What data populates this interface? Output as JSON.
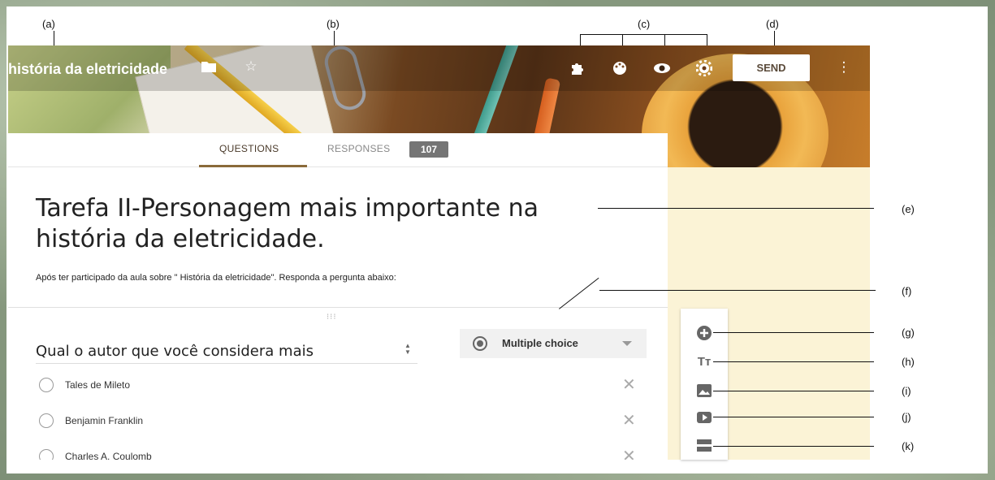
{
  "header": {
    "form_title_short": "história da eletricidade",
    "send_label": "SEND",
    "icons": [
      "folder-icon",
      "star-icon",
      "puzzle-icon",
      "palette-icon",
      "eye-icon",
      "gear-icon",
      "more-vert-icon"
    ]
  },
  "tabs": {
    "questions_label": "QUESTIONS",
    "responses_label": "RESPONSES",
    "responses_count": "107"
  },
  "form": {
    "title_line1": "Tarefa II-Personagem mais importante na",
    "title_line2": "história da eletricidade.",
    "description": "Após ter participado da aula sobre \" História da eletricidade\". Responda a pergunta abaixo:"
  },
  "question": {
    "text": "Qual o autor que você considera mais",
    "type": "Multiple choice",
    "options": [
      "Tales de Mileto",
      "Benjamin Franklin",
      "Charles A. Coulomb"
    ]
  },
  "toolbar": {
    "items": [
      "add-question-icon",
      "title-text-icon",
      "image-icon",
      "video-icon",
      "section-icon"
    ]
  },
  "annotations": {
    "a": "(a)",
    "b": "(b)",
    "c": "(c)",
    "d": "(d)",
    "e": "(e)",
    "f": "(f)",
    "g": "(g)",
    "h": "(h)",
    "i": "(i)",
    "j": "(j)",
    "k": "(k)"
  }
}
